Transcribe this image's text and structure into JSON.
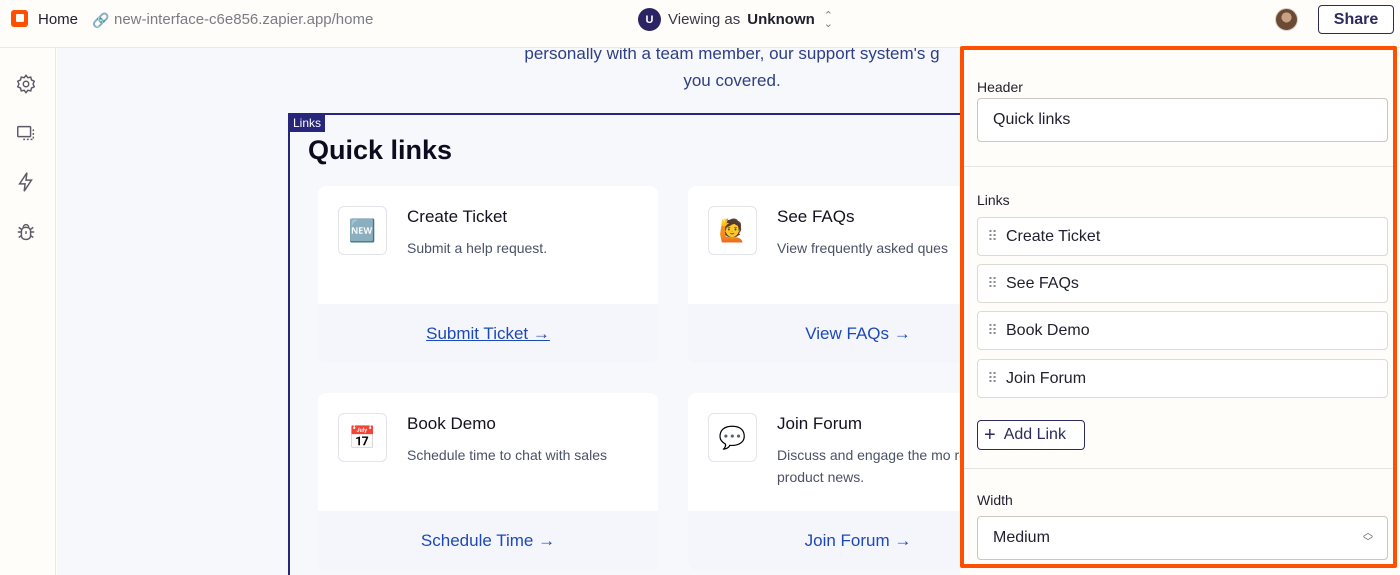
{
  "topbar": {
    "home_label": "Home",
    "url": "new-interface-c6e856.zapier.app/home",
    "viewing_prefix": "Viewing as",
    "viewing_user": "Unknown",
    "viewing_avatar_letter": "U",
    "share_label": "Share"
  },
  "sidebar": {
    "icons": [
      "settings-icon",
      "layout-icon",
      "lightning-icon",
      "debug-icon"
    ]
  },
  "canvas": {
    "intro_line1": "personally with a team member, our support system's g",
    "intro_line2": "you covered.",
    "links_tag": "Links",
    "quick_links_title": "Quick links",
    "cards": [
      {
        "emoji": "🆕",
        "title": "Create Ticket",
        "desc": "Submit a help request.",
        "cta": "Submit Ticket →"
      },
      {
        "emoji": "🙋",
        "title": "See FAQs",
        "desc": "View frequently asked ques",
        "cta": "View FAQs →"
      },
      {
        "emoji": "📅",
        "title": "Book Demo",
        "desc": "Schedule time to chat with sales",
        "cta": "Schedule Time →"
      },
      {
        "emoji": "💬",
        "title": "Join Forum",
        "desc": "Discuss and engage the mo recent product news.",
        "cta": "Join Forum →"
      }
    ]
  },
  "panel": {
    "header_label": "Header",
    "header_value": "Quick links",
    "links_label": "Links",
    "links": [
      "Create Ticket",
      "See FAQs",
      "Book Demo",
      "Join Forum"
    ],
    "add_link_label": "Add Link",
    "width_label": "Width",
    "width_value": "Medium"
  },
  "colors": {
    "accent": "#ff4f00",
    "navy": "#27267a",
    "link": "#1d49b8"
  }
}
